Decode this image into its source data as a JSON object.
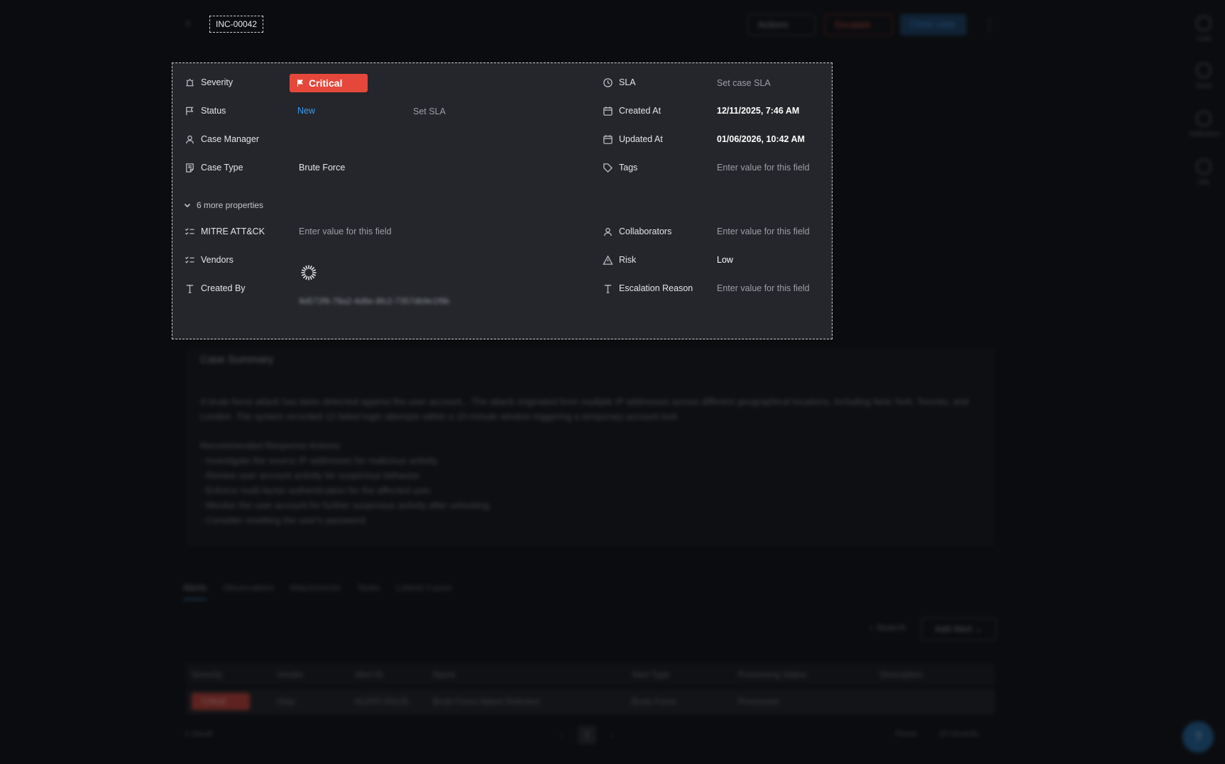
{
  "header": {
    "case_id": "INC-00042",
    "action_1": "Actions",
    "action_2": "Escalate",
    "action_3": "Close case"
  },
  "properties": {
    "severity": {
      "label": "Severity",
      "value": "Critical"
    },
    "status": {
      "label": "Status",
      "value": "New",
      "extra": "Set SLA"
    },
    "case_manager": {
      "label": "Case Manager"
    },
    "case_type": {
      "label": "Case Type",
      "value": "Brute Force"
    },
    "more": "6 more properties",
    "mitre": {
      "label": "MITRE ATT&CK",
      "placeholder": "Enter value for this field"
    },
    "vendors": {
      "label": "Vendors"
    },
    "created_by": {
      "label": "Created By",
      "value": "9d572f6-78a2-4d8e-8fc2-7357db9e1f9b"
    },
    "sla": {
      "label": "SLA",
      "value": "Set case SLA"
    },
    "created_at": {
      "label": "Created At",
      "value": "12/11/2025, 7:46 AM"
    },
    "updated_at": {
      "label": "Updated At",
      "value": "01/06/2026, 10:42 AM"
    },
    "tags": {
      "label": "Tags",
      "placeholder": "Enter value for this field"
    },
    "collaborators": {
      "label": "Collaborators",
      "placeholder": "Enter value for this field"
    },
    "risk": {
      "label": "Risk",
      "value": "Low"
    },
    "escalation_reason": {
      "label": "Escalation Reason",
      "placeholder": "Enter value for this field"
    }
  },
  "summary": {
    "title": "Case Summary",
    "text": "A brute force attack has been detected against the user account... The attack originated from multiple IP addresses across different geographical locations, including New York, Toronto, and London. The system recorded 12 failed login attempts within a 10-minute window triggering a temporary account lock.",
    "actions_title": "Recommended Response Actions:",
    "actions": [
      "- Investigate the source IP addresses for malicious activity.",
      "- Review user account activity for suspicious behavior.",
      "- Enforce multi-factor authentication for the affected user.",
      "- Monitor the user account for further suspicious activity after unlocking.",
      "- Consider resetting the user's password."
    ]
  },
  "tabs": [
    "Alerts",
    "Observables",
    "Attachments",
    "Tasks",
    "Linked Cases"
  ],
  "toolbar": {
    "search": "Search",
    "add": "Add Alert"
  },
  "table": {
    "headers": [
      "Severity",
      "Vendor",
      "Alert ID",
      "Name",
      "Alert Type",
      "Processing Status",
      "Description"
    ],
    "row": {
      "severity": "Critical",
      "vendor": "Okta",
      "alert_id": "ALERT-00128",
      "name": "Brute Force Attack Detected",
      "type": "Brute Force",
      "status": "Processed"
    },
    "count": "1 result",
    "page": "1",
    "rows_label": "Rows",
    "rows_value": "10 records"
  },
  "rail": [
    "Guide",
    "Saved",
    "Notifications",
    "Help"
  ],
  "colors": {
    "critical": "#e5483a",
    "link": "#3b9cf0",
    "panel": "#24262b"
  }
}
